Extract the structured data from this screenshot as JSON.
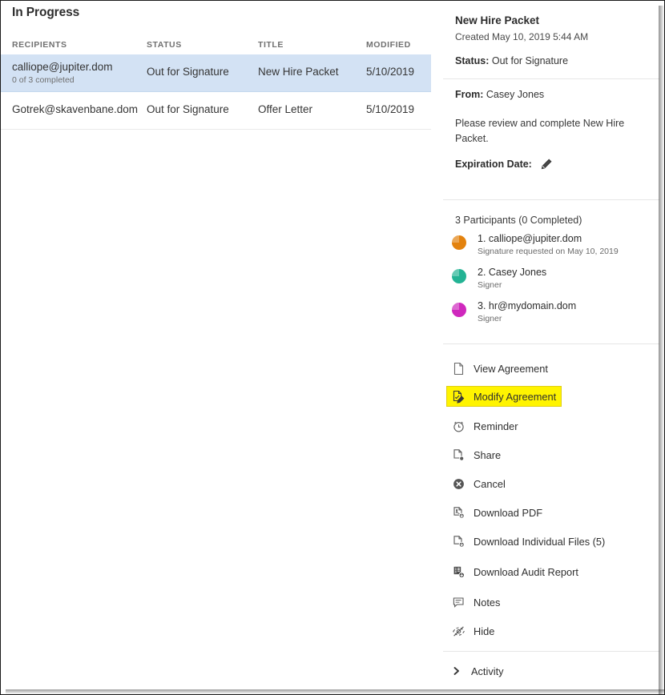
{
  "left": {
    "page_title": "In Progress",
    "columns": [
      "RECIPIENTS",
      "STATUS",
      "TITLE",
      "MODIFIED"
    ],
    "rows": [
      {
        "recipient": "calliope@jupiter.dom",
        "sub": "0 of 3 completed",
        "status": "Out for Signature",
        "title": "New Hire Packet",
        "modified": "5/10/2019",
        "selected": true
      },
      {
        "recipient": "Gotrek@skavenbane.dom",
        "sub": "",
        "status": "Out for Signature",
        "title": "Offer Letter",
        "modified": "5/10/2019",
        "selected": false
      }
    ]
  },
  "right": {
    "title": "New Hire Packet",
    "created": "Created May 10, 2019 5:44 AM",
    "status_label": "Status:",
    "status_value": "Out for Signature",
    "from_label": "From:",
    "from_value": "Casey Jones",
    "message": "Please review and complete New Hire Packet.",
    "expiration_label": "Expiration Date:",
    "expiration_icon": "pencil-icon",
    "participants_heading": "3 Participants (0 Completed)",
    "participants": [
      {
        "name": "1. calliope@jupiter.dom",
        "sub": "Signature requested on May 10, 2019",
        "color": "#e3820e"
      },
      {
        "name": "2. Casey Jones",
        "sub": "Signer",
        "color": "#23b394"
      },
      {
        "name": "3. hr@mydomain.dom",
        "sub": "Signer",
        "color": "#cf28bd"
      }
    ],
    "actions": [
      {
        "label": "View Agreement",
        "icon": "document-icon",
        "highlighted": false
      },
      {
        "label": "Modify Agreement",
        "icon": "document-edit-icon",
        "highlighted": true
      },
      {
        "label": "Reminder",
        "icon": "alarm-clock-icon",
        "highlighted": false
      },
      {
        "label": "Share",
        "icon": "document-share-icon",
        "highlighted": false
      },
      {
        "label": "Cancel",
        "icon": "cancel-circle-icon",
        "highlighted": false
      },
      {
        "label": "Download PDF",
        "icon": "download-pdf-icon",
        "highlighted": false
      },
      {
        "label": "Download Individual Files (5)",
        "icon": "download-files-icon",
        "highlighted": false
      },
      {
        "label": "Download Audit Report",
        "icon": "download-audit-icon",
        "highlighted": false
      },
      {
        "label": "Notes",
        "icon": "note-bubble-icon",
        "highlighted": false
      },
      {
        "label": "Hide",
        "icon": "eye-hidden-icon",
        "highlighted": false
      }
    ],
    "activity_label": "Activity",
    "activity_icon": "chevron-right-icon"
  },
  "colors": {
    "selected_row": "#d3e2f4",
    "highlight": "#fff400",
    "divider": "#e6e6e6"
  }
}
